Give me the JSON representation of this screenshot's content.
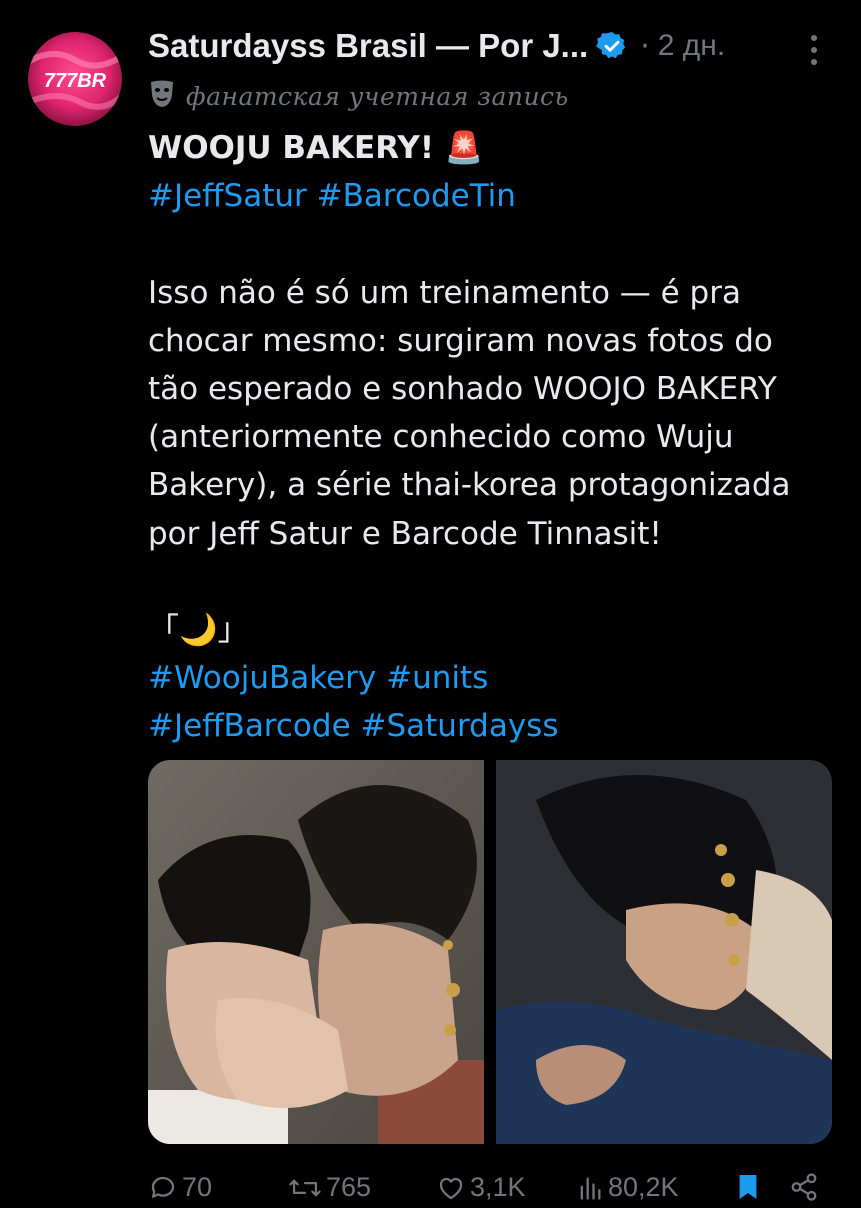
{
  "post": {
    "author": {
      "display_name": "Saturdayss Brasil — Por J...",
      "avatar_text": "777BR",
      "verified": true,
      "verified_color": "#1d9bf0"
    },
    "dot": "·",
    "timestamp": "2 дн.",
    "account_label": "фанатская учетная запись",
    "text_lines": {
      "l1": "WOOJU BAKERY! 🚨",
      "l2a": "#JeffSatur",
      "l2b": "#BarcodeTin",
      "l3": "Isso não é só um treinamento — é pra",
      "l4": "chocar mesmo: surgiram novas fotos do",
      "l5": "tão esperado e sonhado WOOJO BAKERY",
      "l6": "(anteriormente conhecido como Wuju",
      "l7": "Bakery), a série thai-korea protagonizada",
      "l8": "por Jeff Satur e Barcode Tinnasit!",
      "l9": "「🌙」",
      "l10a": "#WoojuBakery",
      "l10b": "#units",
      "l11a": "#JeffBarcode",
      "l11b": "#Saturdayss"
    },
    "metrics": {
      "replies": "70",
      "reposts": "765",
      "likes": "3,1K",
      "views": "80,2K"
    }
  },
  "colors": {
    "background": "#000000",
    "text": "#e7e9ea",
    "muted": "#71767b",
    "link": "#1d9bf0",
    "avatar_pink": "#e0246e"
  },
  "icons": [
    "more-vertical-icon",
    "verified-icon",
    "theater-mask-icon",
    "reply-icon",
    "repost-icon",
    "like-icon",
    "views-icon",
    "bookmark-icon",
    "share-icon"
  ]
}
